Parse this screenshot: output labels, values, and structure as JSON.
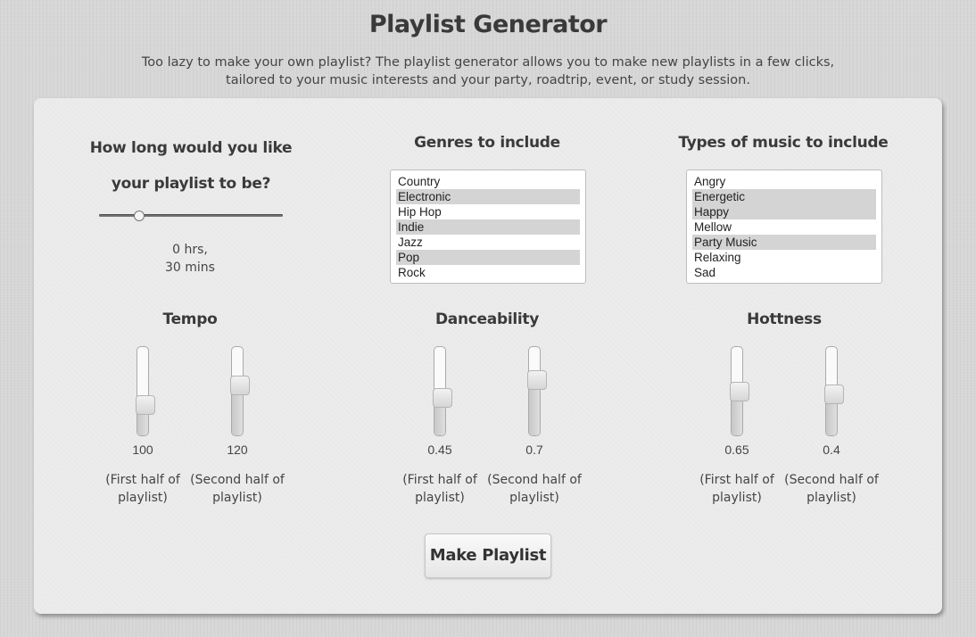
{
  "page": {
    "title": "Playlist Generator",
    "subtitle": "Too lazy to make your own playlist? The playlist generator allows you to make new playlists in a few clicks, tailored to your music interests and your party, roadtrip, event, or study session."
  },
  "length": {
    "heading": "How long would you like your playlist to be?",
    "slider_value": 0.22,
    "hours_text": "0 hrs,",
    "mins_text": "30 mins"
  },
  "genres": {
    "heading": "Genres to include",
    "options": [
      {
        "label": "Country",
        "selected": false
      },
      {
        "label": "Electronic",
        "selected": true
      },
      {
        "label": "Hip Hop",
        "selected": false
      },
      {
        "label": "Indie",
        "selected": true
      },
      {
        "label": "Jazz",
        "selected": false
      },
      {
        "label": "Pop",
        "selected": true
      },
      {
        "label": "Rock",
        "selected": false
      }
    ]
  },
  "types": {
    "heading": "Types of music to include",
    "options": [
      {
        "label": "Angry",
        "selected": false
      },
      {
        "label": "Energetic",
        "selected": true
      },
      {
        "label": "Happy",
        "selected": true
      },
      {
        "label": "Mellow",
        "selected": false
      },
      {
        "label": "Party Music",
        "selected": true
      },
      {
        "label": "Relaxing",
        "selected": false
      },
      {
        "label": "Sad",
        "selected": false
      }
    ]
  },
  "tempo": {
    "heading": "Tempo",
    "first": {
      "value": "100",
      "level": 0.3,
      "note": "(First half of playlist)"
    },
    "second": {
      "value": "120",
      "level": 0.58,
      "note": "(Second half of playlist)"
    }
  },
  "danceability": {
    "heading": "Danceability",
    "first": {
      "value": "0.45",
      "level": 0.4,
      "note": "(First half of playlist)"
    },
    "second": {
      "value": "0.7",
      "level": 0.66,
      "note": "(Second half of playlist)"
    }
  },
  "hottness": {
    "heading": "Hottness",
    "first": {
      "value": "0.65",
      "level": 0.5,
      "note": "(First half of playlist)"
    },
    "second": {
      "value": "0.4",
      "level": 0.45,
      "note": "(Second half of playlist)"
    }
  },
  "make_button": "Make Playlist"
}
